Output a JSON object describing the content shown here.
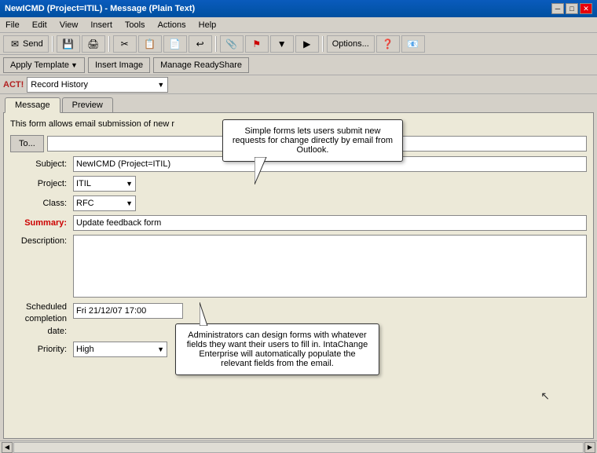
{
  "window": {
    "title": "NewICMD (Project=ITIL) - Message (Plain Text)",
    "minimize_btn": "─",
    "maximize_btn": "□",
    "close_btn": "✕"
  },
  "menu": {
    "items": [
      "File",
      "Edit",
      "View",
      "Insert",
      "Tools",
      "Actions",
      "Help"
    ]
  },
  "toolbar": {
    "send_label": "Send",
    "options_label": "Options...",
    "icons": [
      "💾",
      "🖨️",
      "✂️",
      "📋",
      "📄",
      "🔄",
      "📎",
      "⚠️",
      "▼",
      "▶",
      "📋",
      "📤",
      "❓",
      "📧"
    ]
  },
  "toolbar2": {
    "apply_template": "Apply Template",
    "insert_image": "Insert Image",
    "manage_readyshare": "Manage ReadyShare"
  },
  "act_bar": {
    "label": "ACT!",
    "dropdown_value": "Record History",
    "dropdown_arrow": "▼"
  },
  "tabs": {
    "items": [
      "Message",
      "Preview"
    ],
    "active": "Message"
  },
  "form": {
    "title": "This form allows email submission of new r",
    "to_btn": "To...",
    "to_value": "",
    "subject_label": "Subject:",
    "subject_value": "NewICMD (Project=ITIL)",
    "project_label": "Project:",
    "project_value": "ITIL",
    "project_arrow": "▼",
    "class_label": "Class:",
    "class_value": "RFC",
    "class_arrow": "▼",
    "summary_label": "Summary:",
    "summary_value": "Update feedback form",
    "description_label": "Description:",
    "description_value": "",
    "scheduled_label": "Scheduled\ncompletion\ndate:",
    "scheduled_value": "Fri 21/12/07 17:00",
    "priority_label": "Priority:",
    "priority_value": "High",
    "priority_arrow": "▼"
  },
  "tooltips": {
    "tooltip1_text": "Simple forms lets users submit new requests for change directly by email from Outlook.",
    "tooltip2_text": "Administrators can design forms with whatever fields they want their users to fill in. IntaChange Enterprise will automatically populate the relevant fields from the email."
  },
  "cursor": "↖"
}
